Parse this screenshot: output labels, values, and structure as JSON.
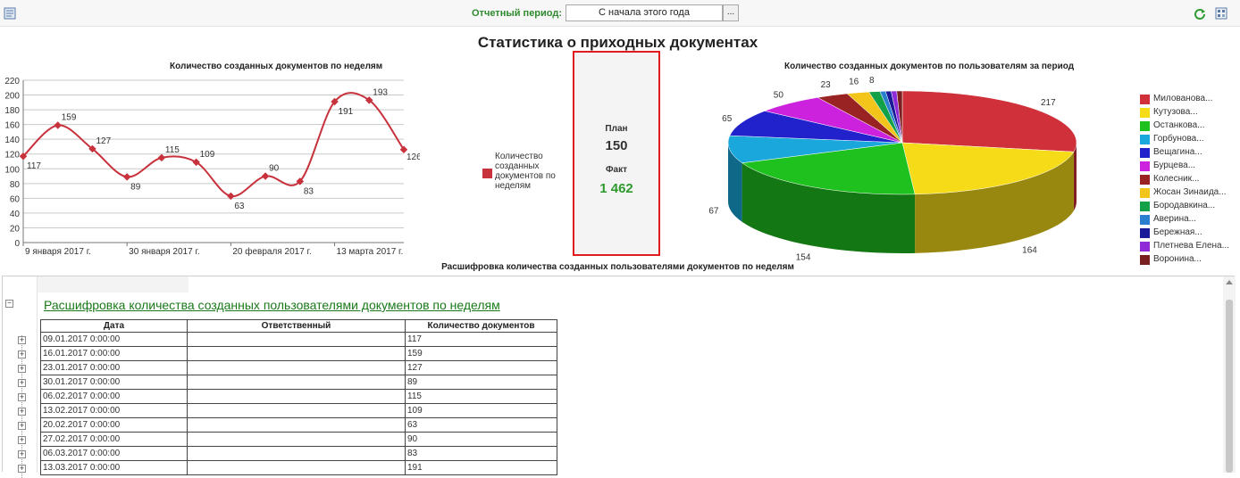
{
  "toolbar": {
    "period_label": "Отчетный период:",
    "period_value": "С начала этого года",
    "period_button": "..."
  },
  "page_title": "Статистика о приходных документах",
  "line_chart": {
    "title": "Количество созданных документов по неделям",
    "legend": "Количество созданных документов по неделям"
  },
  "plan_box": {
    "plan_label": "План",
    "plan_value": "150",
    "fact_label": "Факт",
    "fact_value": "1 462",
    "fact_color": "#2e9a2e"
  },
  "pie_chart": {
    "title": "Количество созданных документов по пользователям за период"
  },
  "chart_data": [
    {
      "type": "line",
      "x": [
        "09.01.2017",
        "16.01.2017",
        "23.01.2017",
        "30.01.2017",
        "06.02.2017",
        "13.02.2017",
        "20.02.2017",
        "27.02.2017",
        "06.03.2017",
        "13.03.2017",
        "20.03.2017",
        "27.03.2017"
      ],
      "values": [
        117,
        159,
        127,
        89,
        115,
        109,
        63,
        90,
        83,
        191,
        193,
        126
      ],
      "x_tick_labels": [
        "9 января 2017 г.",
        "30 января 2017 г.",
        "20 февраля 2017 г.",
        "13 марта 2017 г."
      ],
      "y_ticks": [
        0,
        20,
        40,
        60,
        80,
        100,
        120,
        140,
        160,
        180,
        200,
        220
      ],
      "ylim": [
        0,
        220
      ],
      "grid": true,
      "color": "#c8323c",
      "series_name": "Количество созданных документов по неделям"
    },
    {
      "type": "pie",
      "labels": [
        "Милованова...",
        "Кутузова...",
        "Останкова...",
        "Горбунова...",
        "Вещагина...",
        "Бурцева...",
        "Колесник...",
        "Жосан Зинаида...",
        "Бородавкина...",
        "Аверина...",
        "Бережная...",
        "Плетнева Елена...",
        "Воронина..."
      ],
      "colors": [
        "#d0303a",
        "#f6dc18",
        "#1fc11f",
        "#1aa7dc",
        "#2222cc",
        "#cc22dd",
        "#992222",
        "#f3c51a",
        "#12a048",
        "#2a7fd0",
        "#1a1a99",
        "#8e2ad8",
        "#7a1f1f"
      ],
      "values": [
        217,
        164,
        154,
        67,
        65,
        50,
        23,
        16,
        8
      ],
      "value_labels": [
        "217",
        "164",
        "154",
        "67",
        "65",
        "50",
        "23",
        "16",
        "8"
      ],
      "legend_position": "right"
    }
  ],
  "detail": {
    "title": "Расшифровка количества созданных пользователями документов по неделям",
    "link": "Расшифровка количества созданных пользователями документов по неделям",
    "columns": [
      "Дата",
      "Ответственный",
      "Количество документов"
    ],
    "rows": [
      [
        "09.01.2017 0:00:00",
        "",
        "117"
      ],
      [
        "16.01.2017 0:00:00",
        "",
        "159"
      ],
      [
        "23.01.2017 0:00:00",
        "",
        "127"
      ],
      [
        "30.01.2017 0:00:00",
        "",
        "89"
      ],
      [
        "06.02.2017 0:00:00",
        "",
        "115"
      ],
      [
        "13.02.2017 0:00:00",
        "",
        "109"
      ],
      [
        "20.02.2017 0:00:00",
        "",
        "63"
      ],
      [
        "27.02.2017 0:00:00",
        "",
        "90"
      ],
      [
        "06.03.2017 0:00:00",
        "",
        "83"
      ],
      [
        "13.03.2017 0:00:00",
        "",
        "191"
      ]
    ]
  }
}
